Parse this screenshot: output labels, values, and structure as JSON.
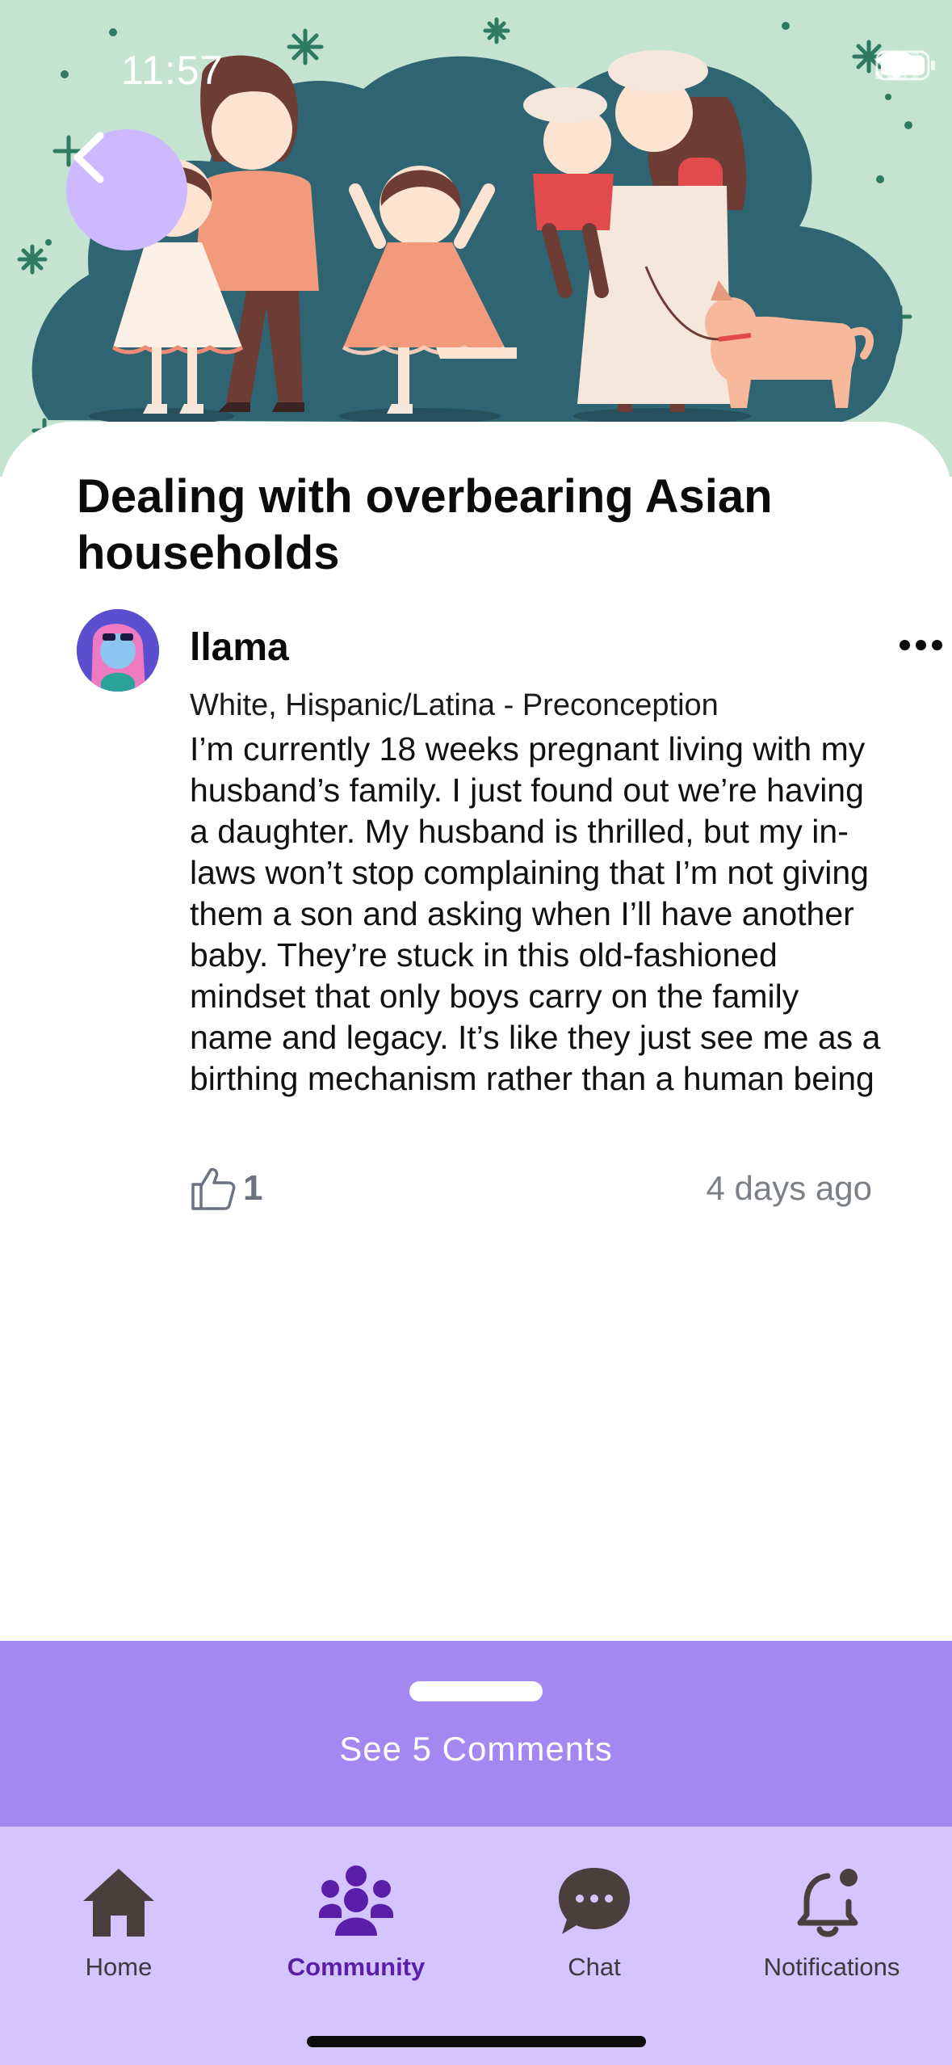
{
  "status_bar": {
    "time": "11:57"
  },
  "header": {
    "back_icon": "chevron-left-icon"
  },
  "post": {
    "title": "Dealing with overbearing Asian households",
    "author": "llama",
    "author_meta": "White, Hispanic/Latina - Preconception",
    "body": "I’m currently 18 weeks pregnant living with my husband’s family. I just found out we’re having a daughter. My husband is thrilled, but my in-laws won’t stop complaining that I’m not giving them a son and asking when I’ll have another baby. They’re stuck in this old-fashioned mindset that only boys carry on the family name and legacy. It’s like they just see me as a birthing mechanism rather than a human being",
    "likes": "1",
    "time_ago": "4 days ago"
  },
  "comments": {
    "label": "See 5 Comments"
  },
  "tabs": [
    {
      "label": "Home",
      "icon": "home-icon"
    },
    {
      "label": "Community",
      "icon": "community-icon",
      "active": true
    },
    {
      "label": "Chat",
      "icon": "chat-icon"
    },
    {
      "label": "Notifications",
      "icon": "bell-icon"
    }
  ],
  "colors": {
    "hero_bg": "#c4e3d1",
    "accent_purple": "#a488f2",
    "tabbar_bg": "#d4c4ff",
    "active_tab": "#5a1ea8"
  }
}
